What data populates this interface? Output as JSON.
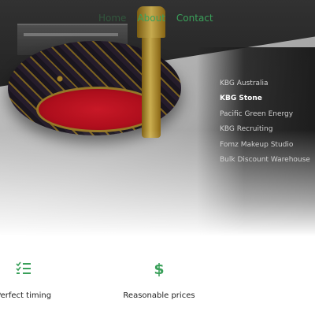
{
  "nav": {
    "items": [
      {
        "label": "Home"
      },
      {
        "label": "About"
      },
      {
        "label": "Contact"
      }
    ]
  },
  "menu": {
    "items": [
      {
        "label": "KBG Australia",
        "active": false
      },
      {
        "label": "KBG Stone",
        "active": true
      },
      {
        "label": "Pacific Green Energy",
        "active": false
      },
      {
        "label": "KBG Recruiting",
        "active": false
      },
      {
        "label": "Fomz Makeup Studio",
        "active": false
      },
      {
        "label": "Bulk Discount Warehouse",
        "active": false
      }
    ]
  },
  "features": [
    {
      "icon": "checklist-icon",
      "label": "Perfect timing"
    },
    {
      "icon": "dollar-icon",
      "label": "Reasonable prices"
    }
  ],
  "colors": {
    "accent": "#3aa05a"
  }
}
